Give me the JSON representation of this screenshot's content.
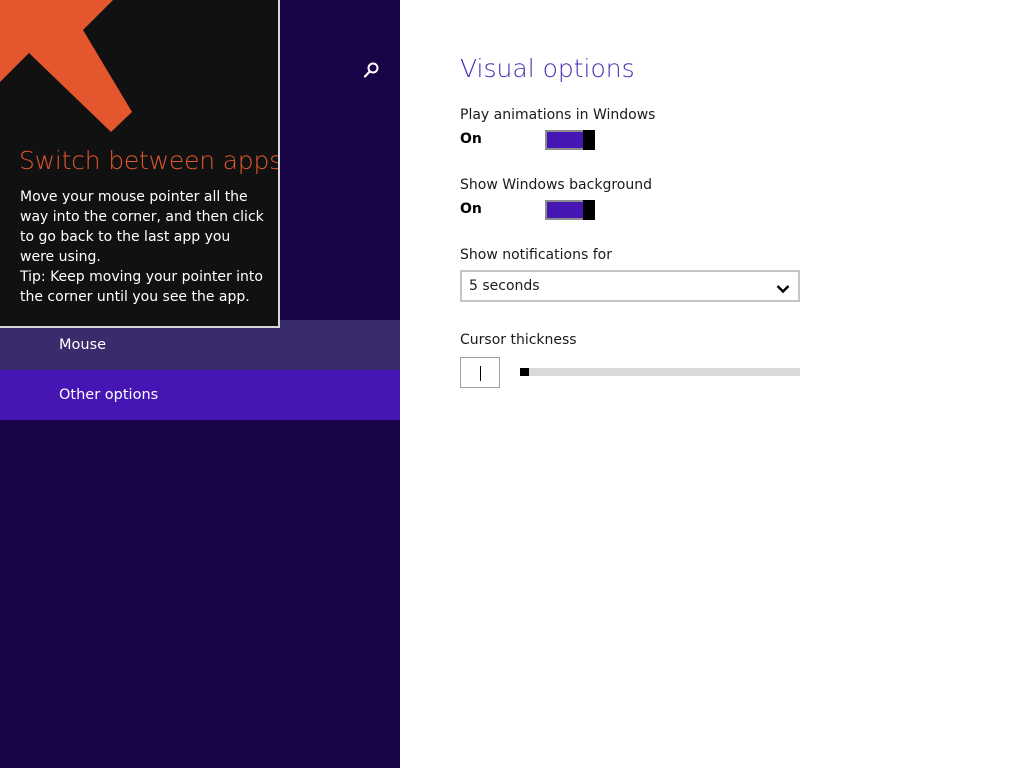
{
  "colors": {
    "left_pane_bg": "#180447",
    "nav_hover": "#3a2c6c",
    "nav_selected": "#4516b4",
    "accent": "#4516b4",
    "title": "#4c2bb1",
    "tip_accent": "#e4572e",
    "tip_bg": "#111111"
  },
  "search": {
    "icon": "search-icon"
  },
  "nav": {
    "items": [
      {
        "label": "Mouse",
        "state": "hover"
      },
      {
        "label": "Other options",
        "state": "selected"
      }
    ]
  },
  "tip": {
    "icon": "arrow-up-left-icon",
    "title": "Switch between apps",
    "body": "Move your mouse pointer all the way into the corner, and then click to go back to the last app you were using.",
    "tip": "Tip: Keep moving your pointer into the corner until you see the app."
  },
  "main": {
    "title": "Visual options",
    "animations": {
      "label": "Play animations in Windows",
      "state": "On"
    },
    "background": {
      "label": "Show Windows background",
      "state": "On"
    },
    "notifications": {
      "label": "Show notifications for",
      "value": "5 seconds",
      "icon": "chevron-down-icon"
    },
    "cursor": {
      "label": "Cursor thickness",
      "value": 1,
      "min": 1,
      "max": 20
    }
  }
}
